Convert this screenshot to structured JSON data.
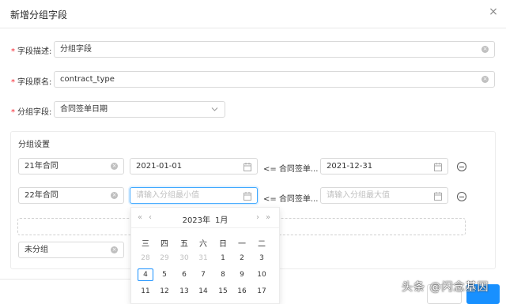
{
  "dialog": {
    "title": "新增分组字段",
    "close_glyph": "×"
  },
  "form": {
    "desc": {
      "label": "字段描述:",
      "value": "分组字段"
    },
    "origin": {
      "label": "字段原名:",
      "value": "contract_type"
    },
    "group_field": {
      "label": "分组字段:",
      "value": "合同签单日期"
    }
  },
  "group_settings": {
    "title": "分组设置",
    "rows": [
      {
        "name": "21年合同",
        "start": "2021-01-01",
        "sep": "<= 合同签单...",
        "end": "2021-12-31"
      },
      {
        "name": "22年合同",
        "start_placeholder": "请输入分组最小值",
        "sep": "<= 合同签单...",
        "end_placeholder": "请输入分组最大值"
      }
    ],
    "ungrouped": "未分组"
  },
  "calendar": {
    "year": "2023年",
    "month": "1月",
    "nav": {
      "prev_year": "«",
      "prev_month": "‹",
      "next_month": "›",
      "next_year": "»"
    },
    "weekdays": [
      "三",
      "四",
      "五",
      "六",
      "日",
      "一",
      "二"
    ],
    "weeks": [
      [
        "28",
        "29",
        "30",
        "31",
        "1",
        "2",
        "3"
      ],
      [
        "4",
        "5",
        "6",
        "7",
        "8",
        "9",
        "10"
      ],
      [
        "11",
        "12",
        "13",
        "14",
        "15",
        "16",
        "17"
      ]
    ],
    "today": "4"
  },
  "watermark": "头条 @闪念基因",
  "colors": {
    "primary": "#1890ff",
    "required": "#f5222d"
  }
}
